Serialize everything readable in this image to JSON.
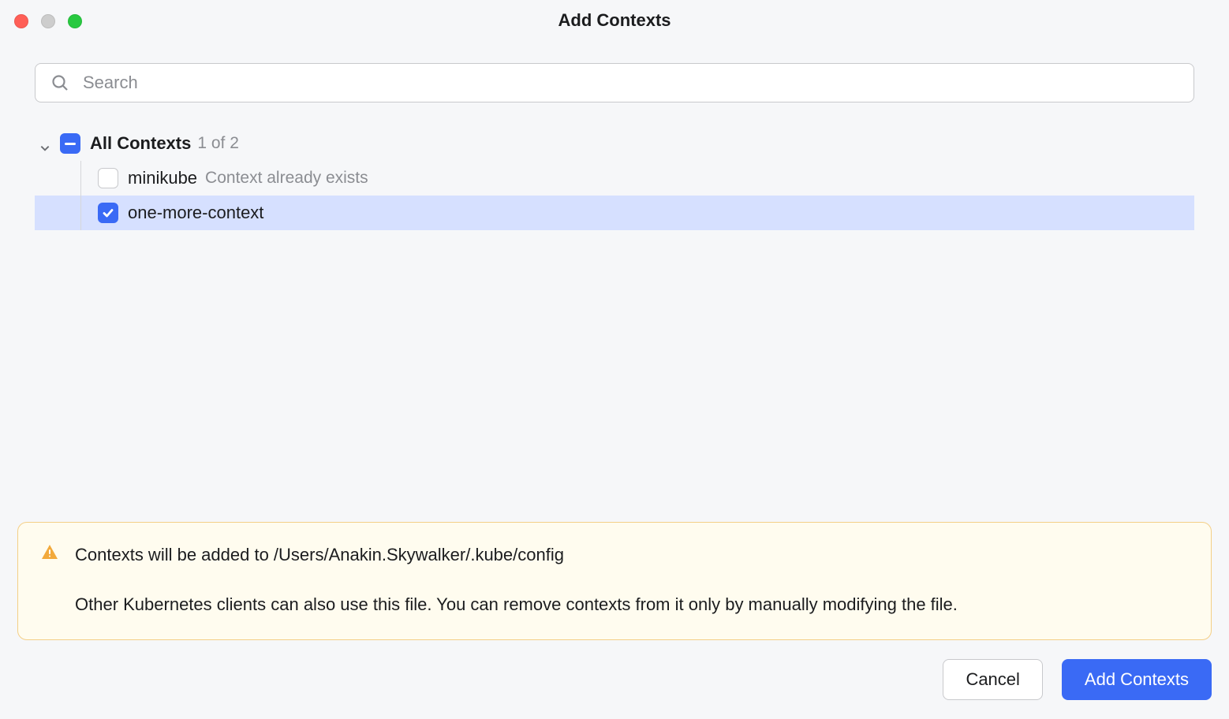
{
  "window": {
    "title": "Add Contexts"
  },
  "search": {
    "placeholder": "Search",
    "value": ""
  },
  "tree": {
    "root_label": "All Contexts",
    "count_text": "1 of 2",
    "items": [
      {
        "label": "minikube",
        "note": "Context already exists",
        "checked": false,
        "selected": false
      },
      {
        "label": "one-more-context",
        "note": "",
        "checked": true,
        "selected": true
      }
    ]
  },
  "notice": {
    "line1": "Contexts will be added to /Users/Anakin.Skywalker/.kube/config",
    "line2": "Other Kubernetes clients can also use this file. You can remove contexts from it only by manually modifying the file."
  },
  "footer": {
    "cancel_label": "Cancel",
    "primary_label": "Add Contexts"
  },
  "colors": {
    "accent": "#3a6af5",
    "selection": "#d6e0ff",
    "notice_bg": "#fffcef",
    "notice_border": "#f4cf87"
  }
}
